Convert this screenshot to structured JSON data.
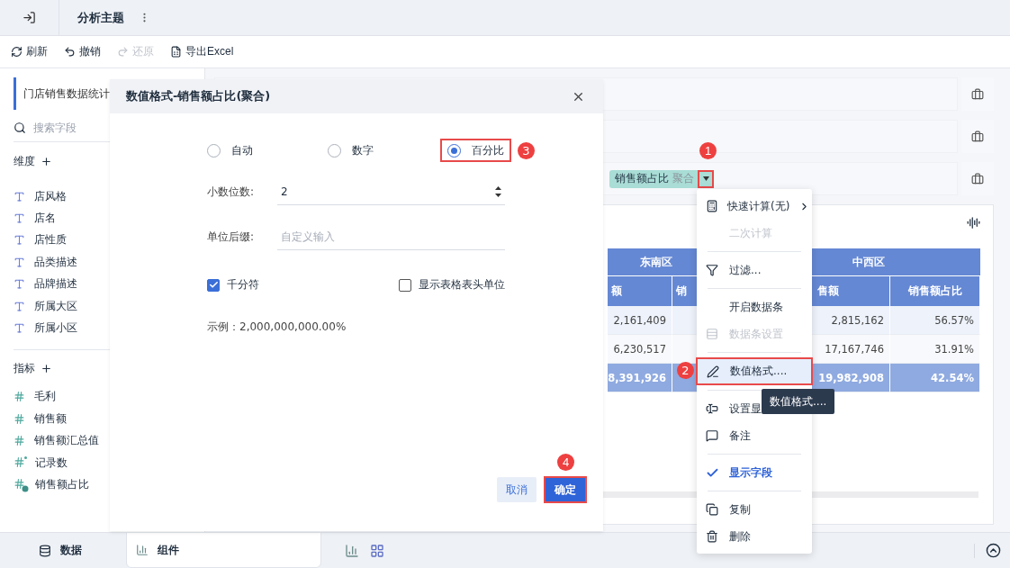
{
  "topbar": {
    "title": "分析主题"
  },
  "toolbar": [
    {
      "label": "刷新",
      "kind": "refresh",
      "disabled": false
    },
    {
      "label": "撤销",
      "kind": "undo",
      "disabled": false
    },
    {
      "label": "还原",
      "kind": "redo",
      "disabled": true
    },
    {
      "label": "导出Excel",
      "kind": "export",
      "disabled": false
    }
  ],
  "sidebar": {
    "dataset": "门店销售数据统计",
    "search_placeholder": "搜索字段",
    "dimensions": {
      "title": "维度",
      "items": [
        "店风格",
        "店名",
        "店性质",
        "品类描述",
        "品牌描述",
        "所属大区",
        "所属小区"
      ]
    },
    "measures": {
      "title": "指标",
      "items": [
        {
          "label": "毛利",
          "kind": "number"
        },
        {
          "label": "销售额",
          "kind": "number"
        },
        {
          "label": "销售额汇总值",
          "kind": "number"
        },
        {
          "label": "记录数",
          "kind": "count"
        },
        {
          "label": "销售额占比",
          "kind": "calc"
        }
      ]
    }
  },
  "shelves": [
    {
      "kind": "empty"
    },
    {
      "kind": "empty"
    },
    {
      "kind": "field",
      "chip": "销售额占比",
      "tag": "聚合",
      "callout": "1"
    }
  ],
  "table": {
    "groups": [
      "东南区",
      "中西区"
    ],
    "columns": [
      "额",
      "销",
      "售额",
      "销售额占比"
    ],
    "rows": [
      {
        "cells": [
          "2,161,409",
          "",
          "2,815,162",
          "56.57%"
        ],
        "selected": false
      },
      {
        "cells": [
          "6,230,517",
          "",
          "17,167,746",
          "31.91%"
        ],
        "selected": false
      },
      {
        "cells": [
          "8,391,926",
          "",
          "19,982,908",
          "42.54%"
        ],
        "selected": true
      }
    ]
  },
  "dialog": {
    "title": "数值格式-销售额占比(聚合)",
    "formats": [
      {
        "label": "自动",
        "selected": false
      },
      {
        "label": "数字",
        "selected": false
      },
      {
        "label": "百分比",
        "selected": true,
        "callout": "3"
      }
    ],
    "decimals": {
      "label": "小数位数:",
      "value": "2"
    },
    "suffix": {
      "label": "单位后缀:",
      "placeholder": "自定义输入"
    },
    "options": [
      {
        "label": "千分符",
        "checked": true
      },
      {
        "label": "显示表格表头单位",
        "checked": false
      }
    ],
    "example": "示例：2,000,000,000.00%",
    "cancel": "取消",
    "confirm": {
      "label": "确定",
      "callout": "4"
    }
  },
  "menu": {
    "items": [
      {
        "kind": "calc",
        "label": "快速计算(无)",
        "submenu": true,
        "disabled": false
      },
      {
        "kind": "plain",
        "label": "二次计算",
        "disabled": true
      },
      {
        "kind": "divider"
      },
      {
        "kind": "filter",
        "label": "过滤...",
        "disabled": false
      },
      {
        "kind": "divider"
      },
      {
        "kind": "plain",
        "label": "开启数据条",
        "disabled": false
      },
      {
        "kind": "bars",
        "label": "数据条设置",
        "disabled": true
      },
      {
        "kind": "divider"
      },
      {
        "kind": "format",
        "label": "数值格式....",
        "disabled": false,
        "highlighted": true,
        "callout": "2"
      },
      {
        "kind": "divider"
      },
      {
        "kind": "display",
        "label": "设置显",
        "disabled": false
      },
      {
        "kind": "note",
        "label": "备注",
        "disabled": false
      },
      {
        "kind": "divider"
      },
      {
        "kind": "plain",
        "label": "显示字段",
        "disabled": false,
        "checked": true
      },
      {
        "kind": "divider"
      },
      {
        "kind": "copy",
        "label": "复制",
        "disabled": false
      },
      {
        "kind": "delete",
        "label": "删除",
        "disabled": false
      }
    ]
  },
  "tooltip": "数值格式....",
  "bottom_tabs": [
    {
      "label": "数据",
      "kind": "data",
      "selected": false
    },
    {
      "label": "组件",
      "kind": "widget",
      "selected": true
    }
  ]
}
